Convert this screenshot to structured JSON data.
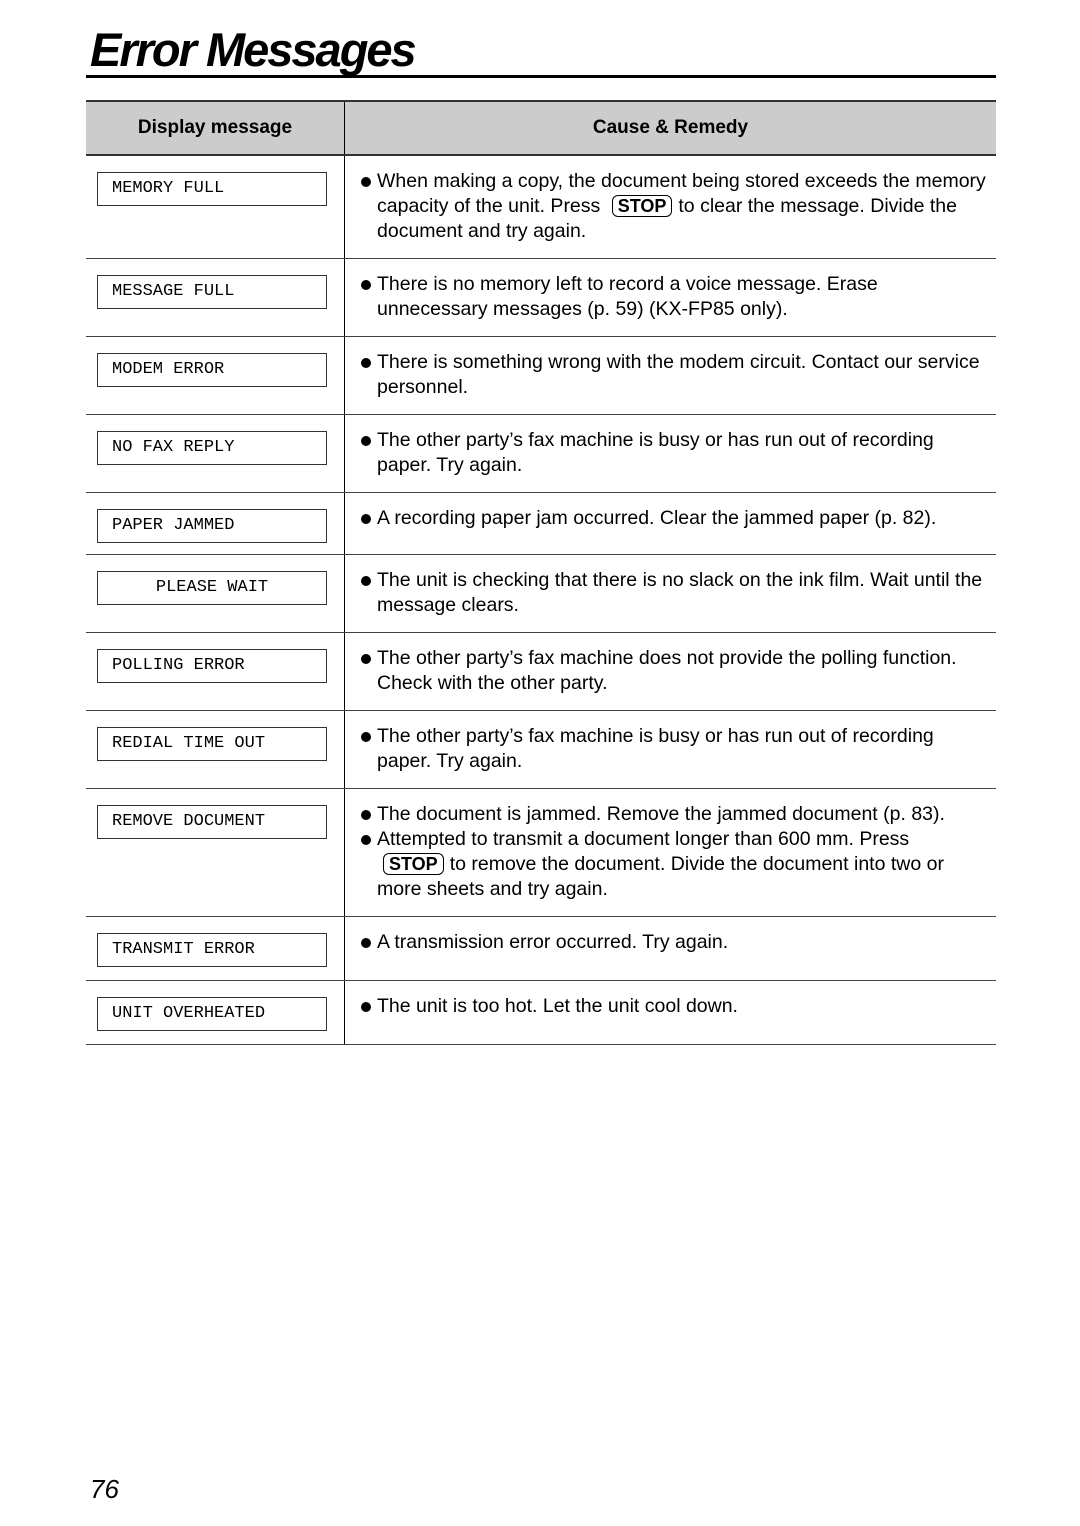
{
  "page": {
    "title": "Error Messages",
    "page_number": "76"
  },
  "table": {
    "headers": {
      "display": "Display message",
      "cause": "Cause & Remedy"
    },
    "rows": [
      {
        "display": "MEMORY FULL",
        "center": false,
        "remedies": [
          {
            "parts": [
              {
                "t": "When making a copy, the document being stored exceeds the memory capacity of the unit. Press"
              },
              {
                "key": "STOP"
              },
              {
                "t": "to clear the message. Divide the document and try again."
              }
            ]
          }
        ]
      },
      {
        "display": "MESSAGE FULL",
        "center": false,
        "remedies": [
          {
            "parts": [
              {
                "t": "There is no memory left to record a voice message. Erase unnecessary messages (p. 59) (KX-FP85 only)."
              }
            ]
          }
        ]
      },
      {
        "display": "MODEM ERROR",
        "center": false,
        "remedies": [
          {
            "parts": [
              {
                "t": "There is something wrong with the modem circuit. Contact our service personnel."
              }
            ]
          }
        ]
      },
      {
        "display": "NO FAX REPLY",
        "center": false,
        "remedies": [
          {
            "parts": [
              {
                "t": "The other party’s fax machine is busy or has run out of recording paper. Try again."
              }
            ]
          }
        ]
      },
      {
        "display": "PAPER JAMMED",
        "center": false,
        "remedies": [
          {
            "parts": [
              {
                "t": "A recording paper jam occurred. Clear the jammed paper (p. 82)."
              }
            ]
          }
        ]
      },
      {
        "display": "PLEASE WAIT",
        "center": true,
        "remedies": [
          {
            "parts": [
              {
                "t": "The unit is checking that there is no slack on the ink film. Wait until the message clears."
              }
            ]
          }
        ]
      },
      {
        "display": "POLLING ERROR",
        "center": false,
        "remedies": [
          {
            "parts": [
              {
                "t": "The other party’s fax machine does not provide the polling function. Check with the other party."
              }
            ]
          }
        ]
      },
      {
        "display": "REDIAL TIME OUT",
        "center": false,
        "remedies": [
          {
            "parts": [
              {
                "t": "The other party’s fax machine is busy or has run out of recording paper. Try again."
              }
            ]
          }
        ]
      },
      {
        "display": "REMOVE DOCUMENT",
        "center": false,
        "remedies": [
          {
            "parts": [
              {
                "t": "The document is jammed. Remove the jammed document (p. 83)."
              }
            ]
          },
          {
            "parts": [
              {
                "t": "Attempted to transmit a document longer than 600 mm. Press"
              },
              {
                "key": "STOP"
              },
              {
                "t": "to remove the document. Divide the document into two or more sheets and try again."
              }
            ]
          }
        ]
      },
      {
        "display": "TRANSMIT ERROR",
        "center": false,
        "remedies": [
          {
            "parts": [
              {
                "t": "A transmission error occurred. Try again."
              }
            ]
          }
        ]
      },
      {
        "display": "UNIT OVERHEATED",
        "center": false,
        "remedies": [
          {
            "parts": [
              {
                "t": "The unit is too hot. Let the unit cool down."
              }
            ]
          }
        ]
      }
    ]
  }
}
